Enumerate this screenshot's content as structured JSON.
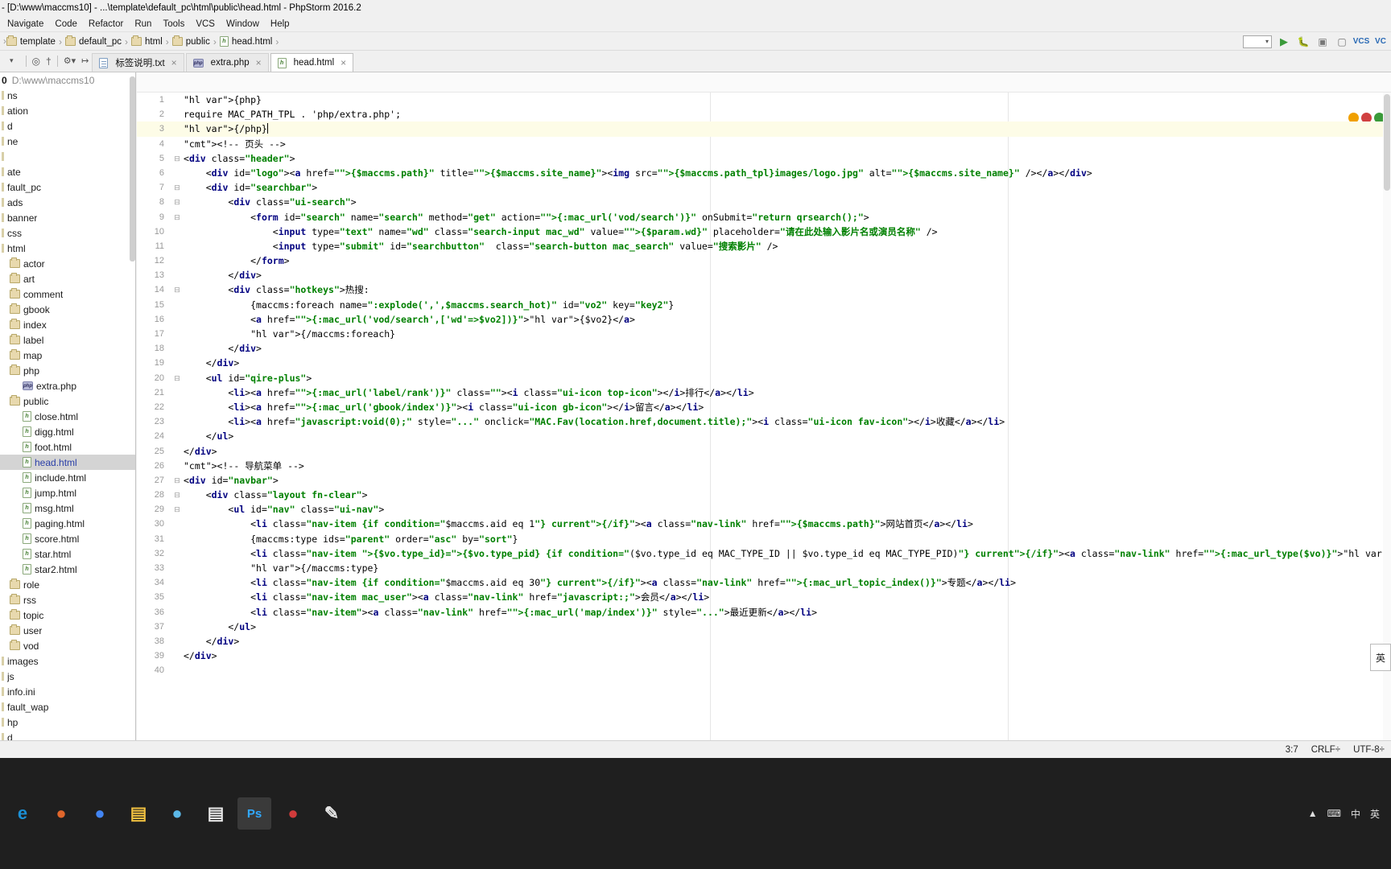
{
  "window": {
    "title": "- [D:\\www\\maccms10] - ...\\template\\default_pc\\html\\public\\head.html - PhpStorm 2016.2"
  },
  "menubar": {
    "items": [
      "Navigate",
      "Code",
      "Refactor",
      "Run",
      "Tools",
      "VCS",
      "Window",
      "Help"
    ]
  },
  "breadcrumb": {
    "items": [
      {
        "label": "template",
        "icon": "folder-icon"
      },
      {
        "label": "default_pc",
        "icon": "folder-icon"
      },
      {
        "label": "html",
        "icon": "folder-icon"
      },
      {
        "label": "public",
        "icon": "folder-icon"
      },
      {
        "label": "head.html",
        "icon": "html-file-icon"
      }
    ]
  },
  "tabs": [
    {
      "label": "标签说明.txt",
      "icon": "text-file-icon",
      "active": false
    },
    {
      "label": "extra.php",
      "icon": "php-file-icon",
      "active": false
    },
    {
      "label": "head.html",
      "icon": "html-file-icon",
      "active": true
    }
  ],
  "project_tree": {
    "root_label": "0",
    "root_path": "D:\\www\\maccms10",
    "rows": [
      {
        "label": "ns",
        "indent": 0,
        "icon": "none",
        "selected": false
      },
      {
        "label": "ation",
        "indent": 0,
        "icon": "none",
        "selected": false
      },
      {
        "label": "d",
        "indent": 0,
        "icon": "none",
        "selected": false
      },
      {
        "label": "ne",
        "indent": 0,
        "icon": "none",
        "selected": false
      },
      {
        "label": "",
        "indent": 0,
        "icon": "none",
        "selected": false
      },
      {
        "label": "ate",
        "indent": 0,
        "icon": "none",
        "selected": false
      },
      {
        "label": "fault_pc",
        "indent": 0,
        "icon": "none",
        "selected": false
      },
      {
        "label": "ads",
        "indent": 0,
        "icon": "none",
        "selected": false
      },
      {
        "label": "banner",
        "indent": 0,
        "icon": "none",
        "selected": false
      },
      {
        "label": "css",
        "indent": 0,
        "icon": "none",
        "selected": false
      },
      {
        "label": "html",
        "indent": 0,
        "icon": "none",
        "selected": false
      },
      {
        "label": "actor",
        "indent": 1,
        "icon": "folder-icon",
        "selected": false
      },
      {
        "label": "art",
        "indent": 1,
        "icon": "folder-icon",
        "selected": false
      },
      {
        "label": "comment",
        "indent": 1,
        "icon": "folder-icon",
        "selected": false
      },
      {
        "label": "gbook",
        "indent": 1,
        "icon": "folder-icon",
        "selected": false
      },
      {
        "label": "index",
        "indent": 1,
        "icon": "folder-icon",
        "selected": false
      },
      {
        "label": "label",
        "indent": 1,
        "icon": "folder-icon",
        "selected": false
      },
      {
        "label": "map",
        "indent": 1,
        "icon": "folder-icon",
        "selected": false
      },
      {
        "label": "php",
        "indent": 1,
        "icon": "folder-icon",
        "selected": false
      },
      {
        "label": "extra.php",
        "indent": 2,
        "icon": "php-file-icon",
        "selected": false
      },
      {
        "label": "public",
        "indent": 1,
        "icon": "folder-icon",
        "selected": false
      },
      {
        "label": "close.html",
        "indent": 2,
        "icon": "html-file-icon",
        "selected": false
      },
      {
        "label": "digg.html",
        "indent": 2,
        "icon": "html-file-icon",
        "selected": false
      },
      {
        "label": "foot.html",
        "indent": 2,
        "icon": "html-file-icon",
        "selected": false
      },
      {
        "label": "head.html",
        "indent": 2,
        "icon": "html-file-icon",
        "selected": true
      },
      {
        "label": "include.html",
        "indent": 2,
        "icon": "html-file-icon",
        "selected": false
      },
      {
        "label": "jump.html",
        "indent": 2,
        "icon": "html-file-icon",
        "selected": false
      },
      {
        "label": "msg.html",
        "indent": 2,
        "icon": "html-file-icon",
        "selected": false
      },
      {
        "label": "paging.html",
        "indent": 2,
        "icon": "html-file-icon",
        "selected": false
      },
      {
        "label": "score.html",
        "indent": 2,
        "icon": "html-file-icon",
        "selected": false
      },
      {
        "label": "star.html",
        "indent": 2,
        "icon": "html-file-icon",
        "selected": false
      },
      {
        "label": "star2.html",
        "indent": 2,
        "icon": "html-file-icon",
        "selected": false
      },
      {
        "label": "role",
        "indent": 1,
        "icon": "folder-icon",
        "selected": false
      },
      {
        "label": "rss",
        "indent": 1,
        "icon": "folder-icon",
        "selected": false
      },
      {
        "label": "topic",
        "indent": 1,
        "icon": "folder-icon",
        "selected": false
      },
      {
        "label": "user",
        "indent": 1,
        "icon": "folder-icon",
        "selected": false
      },
      {
        "label": "vod",
        "indent": 1,
        "icon": "folder-icon",
        "selected": false
      },
      {
        "label": "images",
        "indent": 0,
        "icon": "none",
        "selected": false
      },
      {
        "label": "js",
        "indent": 0,
        "icon": "none",
        "selected": false
      },
      {
        "label": "info.ini",
        "indent": 0,
        "icon": "none",
        "selected": false
      },
      {
        "label": "fault_wap",
        "indent": 0,
        "icon": "none",
        "selected": false
      },
      {
        "label": "hp",
        "indent": 0,
        "icon": "none",
        "selected": false
      },
      {
        "label": "d",
        "indent": 0,
        "icon": "none",
        "selected": false
      }
    ]
  },
  "editor": {
    "current_line": 3,
    "total_lines": 40,
    "lines": [
      {
        "n": 1,
        "fold": "",
        "text": "{php}"
      },
      {
        "n": 2,
        "fold": "",
        "text": "require MAC_PATH_TPL . 'php/extra.php';"
      },
      {
        "n": 3,
        "fold": "",
        "text": "{/php}"
      },
      {
        "n": 4,
        "fold": "",
        "text": "<!-- 页头 -->"
      },
      {
        "n": 5,
        "fold": "-",
        "text": "<div class=\"header\">"
      },
      {
        "n": 6,
        "fold": "",
        "text": "    <div id=\"logo\"><a href=\"{$maccms.path}\" title=\"{$maccms.site_name}\"><img src=\"{$maccms.path_tpl}images/logo.jpg\" alt=\"{$maccms.site_name}\" /></a></div>"
      },
      {
        "n": 7,
        "fold": "-",
        "text": "    <div id=\"searchbar\">"
      },
      {
        "n": 8,
        "fold": "-",
        "text": "        <div class=\"ui-search\">"
      },
      {
        "n": 9,
        "fold": "-",
        "text": "            <form id=\"search\" name=\"search\" method=\"get\" action=\"{:mac_url('vod/search')}\" onSubmit=\"return qrsearch();\">"
      },
      {
        "n": 10,
        "fold": "",
        "text": "                <input type=\"text\" name=\"wd\" class=\"search-input mac_wd\" value=\"{$param.wd}\" placeholder=\"请在此处输入影片名或演员名称\" />"
      },
      {
        "n": 11,
        "fold": "",
        "text": "                <input type=\"submit\" id=\"searchbutton\"  class=\"search-button mac_search\" value=\"搜索影片\" />"
      },
      {
        "n": 12,
        "fold": "",
        "text": "            </form>"
      },
      {
        "n": 13,
        "fold": "",
        "text": "        </div>"
      },
      {
        "n": 14,
        "fold": "-",
        "text": "        <div class=\"hotkeys\">热搜:"
      },
      {
        "n": 15,
        "fold": "",
        "text": "            {maccms:foreach name=\":explode(',',$maccms.search_hot)\" id=\"vo2\" key=\"key2\"}"
      },
      {
        "n": 16,
        "fold": "",
        "text": "            <a href=\"{:mac_url('vod/search',['wd'=>$vo2])}\">{$vo2}</a>"
      },
      {
        "n": 17,
        "fold": "",
        "text": "            {/maccms:foreach}"
      },
      {
        "n": 18,
        "fold": "",
        "text": "        </div>"
      },
      {
        "n": 19,
        "fold": "",
        "text": "    </div>"
      },
      {
        "n": 20,
        "fold": "-",
        "text": "    <ul id=\"qire-plus\">"
      },
      {
        "n": 21,
        "fold": "",
        "text": "        <li><a href=\"{:mac_url('label/rank')}\" class=\"\"><i class=\"ui-icon top-icon\"></i>排行</a></li>"
      },
      {
        "n": 22,
        "fold": "",
        "text": "        <li><a href=\"{:mac_url('gbook/index')}\"><i class=\"ui-icon gb-icon\"></i>留言</a></li>"
      },
      {
        "n": 23,
        "fold": "",
        "text": "        <li><a href=\"javascript:void(0);\" style=\"...\" onclick=\"MAC.Fav(location.href,document.title);\"><i class=\"ui-icon fav-icon\"></i>收藏</a></li>"
      },
      {
        "n": 24,
        "fold": "",
        "text": "    </ul>"
      },
      {
        "n": 25,
        "fold": "",
        "text": "</div>"
      },
      {
        "n": 26,
        "fold": "",
        "text": "<!-- 导航菜单 -->"
      },
      {
        "n": 27,
        "fold": "-",
        "text": "<div id=\"navbar\">"
      },
      {
        "n": 28,
        "fold": "-",
        "text": "    <div class=\"layout fn-clear\">"
      },
      {
        "n": 29,
        "fold": "-",
        "text": "        <ul id=\"nav\" class=\"ui-nav\">"
      },
      {
        "n": 30,
        "fold": "",
        "text": "            <li class=\"nav-item {if condition=\"$maccms.aid eq 1\"} current{/if}\"><a class=\"nav-link\" href=\"{$maccms.path}\">网站首页</a></li>"
      },
      {
        "n": 31,
        "fold": "",
        "text": "            {maccms:type ids=\"parent\" order=\"asc\" by=\"sort\"}"
      },
      {
        "n": 32,
        "fold": "",
        "text": "            <li class=\"nav-item {$vo.type_id}={$vo.type_pid} {if condition=\"($vo.type_id eq MAC_TYPE_ID || $vo.type_id eq MAC_TYPE_PID)\"} current{/if}\"><a class=\"nav-link\" href=\"{:mac_url_type($vo)}\">{$vo.type_name}</a>"
      },
      {
        "n": 33,
        "fold": "",
        "text": "            {/maccms:type}"
      },
      {
        "n": 34,
        "fold": "",
        "text": "            <li class=\"nav-item {if condition=\"$maccms.aid eq 30\"} current{/if}\"><a class=\"nav-link\" href=\"{:mac_url_topic_index()}\">专题</a></li>"
      },
      {
        "n": 35,
        "fold": "",
        "text": "            <li class=\"nav-item mac_user\"><a class=\"nav-link\" href=\"javascript:;\">会员</a></li>"
      },
      {
        "n": 36,
        "fold": "",
        "text": "            <li class=\"nav-item\"><a class=\"nav-link\" href=\"{:mac_url('map/index')}\" style=\"...\">最近更新</a></li>"
      },
      {
        "n": 37,
        "fold": "",
        "text": "        </ul>"
      },
      {
        "n": 38,
        "fold": "",
        "text": "    </div>"
      },
      {
        "n": 39,
        "fold": "",
        "text": "</div>"
      },
      {
        "n": 40,
        "fold": "",
        "text": ""
      }
    ]
  },
  "ime": {
    "label": "英"
  },
  "statusbar": {
    "caret": "3:7",
    "line_separator": "CRLF÷",
    "encoding": "UTF-8÷"
  },
  "taskbar": {
    "items": [
      {
        "name": "edge-icon",
        "glyph": "e",
        "color": "#1b8fd4",
        "active": false
      },
      {
        "name": "firefox-icon",
        "glyph": "●",
        "color": "#e0662b",
        "active": false
      },
      {
        "name": "chrome-icon",
        "glyph": "●",
        "color": "#4285f4",
        "active": false
      },
      {
        "name": "file-explorer-icon",
        "glyph": "▤",
        "color": "#f0c040",
        "active": false
      },
      {
        "name": "qq-icon",
        "glyph": "●",
        "color": "#5bb8e8",
        "active": false
      },
      {
        "name": "notepad-icon",
        "glyph": "▤",
        "color": "#e8e8e8",
        "active": false
      },
      {
        "name": "photoshop-icon",
        "glyph": "Ps",
        "color": "#31a8ff",
        "active": true
      },
      {
        "name": "recorder-icon",
        "glyph": "●",
        "color": "#d13b3b",
        "active": false
      },
      {
        "name": "editor-icon",
        "glyph": "✎",
        "color": "#e8e8e8",
        "active": false
      }
    ],
    "tray": [
      "▲",
      "⌨",
      "中",
      "英"
    ]
  },
  "colors": {
    "accent": "#2b40a8",
    "string": "#008000",
    "tag": "#000080",
    "comment": "#808080",
    "highlight": "#fbf4cc",
    "current_line": "#fdfce7"
  }
}
